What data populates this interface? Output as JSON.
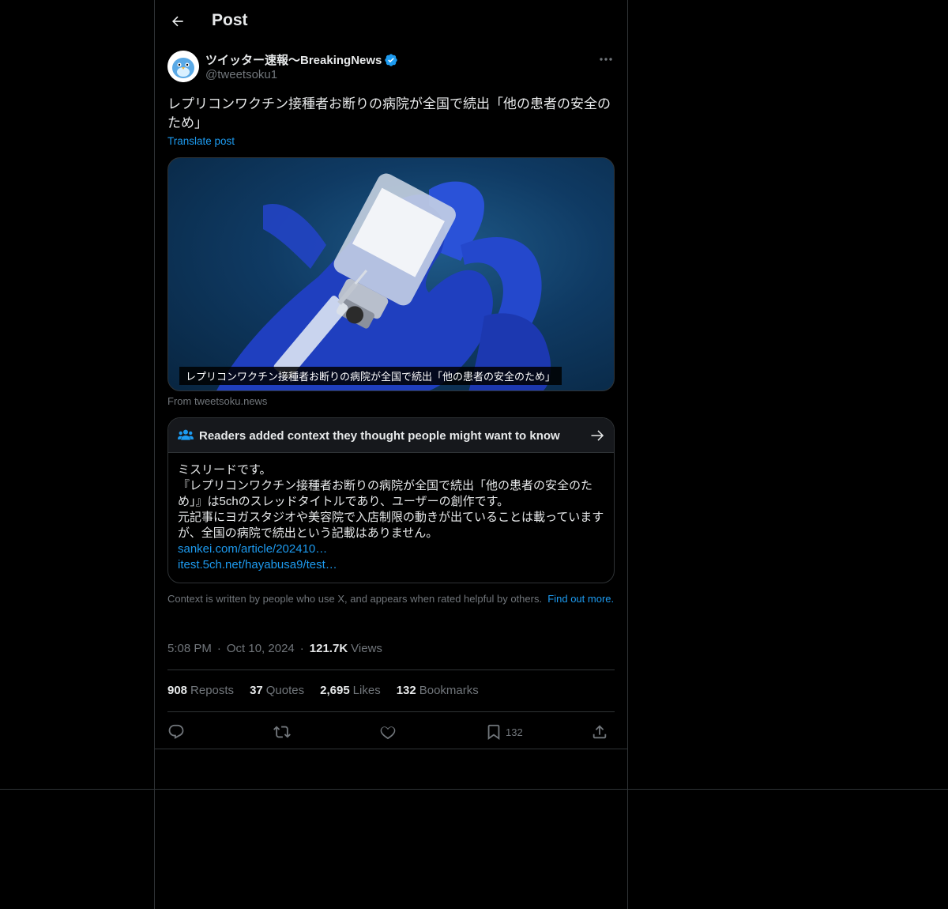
{
  "header": {
    "title": "Post"
  },
  "author": {
    "display_name": "ツイッター速報〜BreakingNews",
    "handle": "@tweetsoku1",
    "verified": true
  },
  "tweet": {
    "text": "レプリコンワクチン接種者お断りの病院が全国で続出「他の患者の安全のため」",
    "translate_label": "Translate post",
    "media_caption": "レプリコンワクチン接種者お断りの病院が全国で続出「他の患者の安全のため」",
    "source": "From tweetsoku.news"
  },
  "community_note": {
    "title": "Readers added context they thought people might want to know",
    "lines": [
      "ミスリードです。",
      "『レプリコンワクチン接種者お断りの病院が全国で続出「他の患者の安全のた",
      "め」』は5chのスレッドタイトルであり、ユーザーの創作です。",
      "元記事にヨガスタジオや美容院で入店制限の動きが出ていることは載っています",
      "が、全国の病院で続出という記載はありません。"
    ],
    "links": [
      "sankei.com/article/202410…",
      "itest.5ch.net/hayabusa9/test…"
    ]
  },
  "context_note": {
    "text": "Context is written by people who use X, and appears when rated helpful by others.",
    "link": "Find out more."
  },
  "meta": {
    "time": "5:08 PM",
    "date": "Oct 10, 2024",
    "views_count": "121.7K",
    "views_label": "Views"
  },
  "stats": {
    "reposts_count": "908",
    "reposts_label": "Reposts",
    "quotes_count": "37",
    "quotes_label": "Quotes",
    "likes_count": "2,695",
    "likes_label": "Likes",
    "bookmarks_count": "132",
    "bookmarks_label": "Bookmarks"
  },
  "actions": {
    "bookmark_count": "132"
  },
  "colors": {
    "accent": "#1d9bf0",
    "muted": "#71767b",
    "border": "#2f3336",
    "background": "#000000"
  },
  "icons": [
    "back-arrow-icon",
    "verified-badge-icon",
    "more-icon",
    "people-icon",
    "arrow-right-icon",
    "reply-icon",
    "repost-icon",
    "like-icon",
    "bookmark-icon",
    "share-icon"
  ]
}
